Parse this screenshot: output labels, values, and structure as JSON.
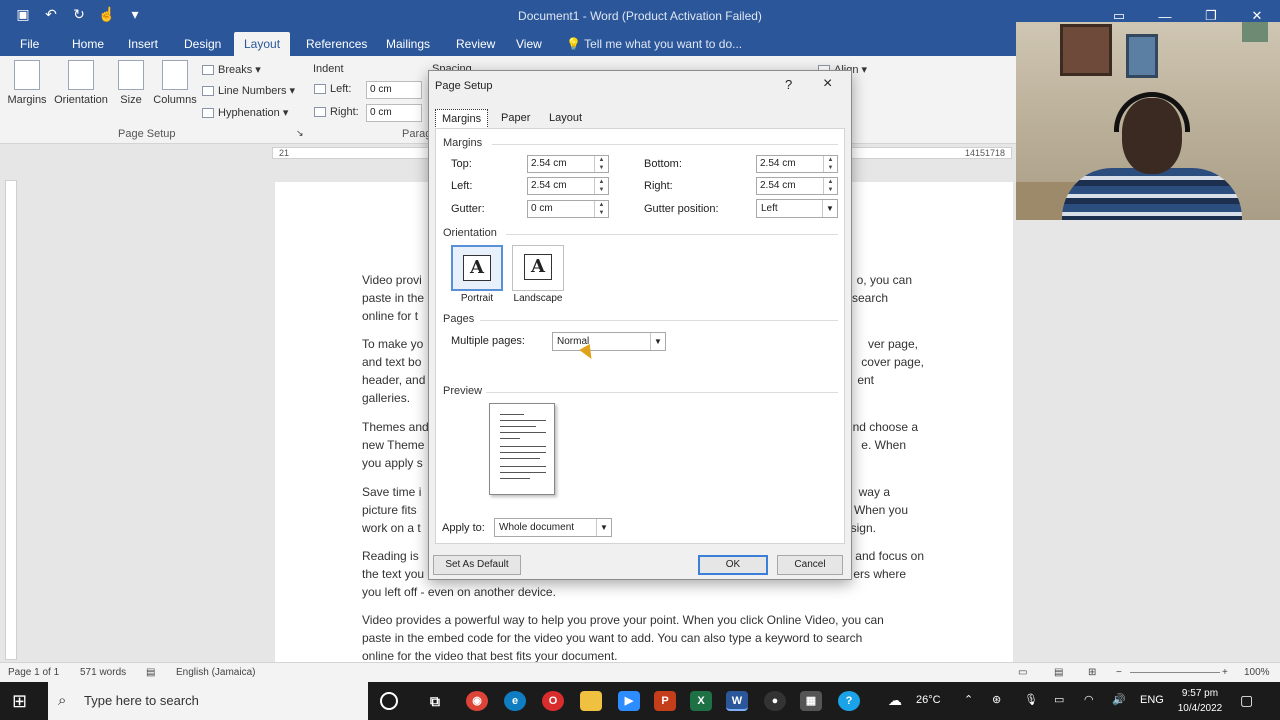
{
  "titlebar": {
    "title": "Document1 - Word (Product Activation Failed)",
    "qat_icons": [
      "save-icon",
      "undo-icon",
      "redo-icon",
      "touch-mode-icon",
      "customize-icon"
    ],
    "win_icons": [
      "ribbon-display-icon",
      "minimize-icon",
      "restore-icon",
      "close-icon"
    ]
  },
  "ribbon_tabs": [
    "File",
    "Home",
    "Insert",
    "Design",
    "Layout",
    "References",
    "Mailings",
    "Review",
    "View"
  ],
  "active_tab": "Layout",
  "tell_me": "Tell me what you want to do...",
  "ribbon": {
    "margins": "Margins",
    "orientation": "Orientation",
    "size": "Size",
    "columns": "Columns",
    "breaks": "Breaks",
    "line_numbers": "Line Numbers",
    "hyphenation": "Hyphenation",
    "page_setup_group": "Page Setup",
    "indent": "Indent",
    "left_label": "Left:",
    "left_value": "0 cm",
    "right_label": "Right:",
    "right_value": "0 cm",
    "spacing": "Spacing",
    "para_group": "Parag",
    "align": "Align"
  },
  "ruler_ticks": [
    "2",
    "1",
    "14",
    "15",
    "17",
    "18"
  ],
  "document": {
    "paragraphs": [
      {
        "left": "Video provi",
        "right": "o, you can"
      },
      {
        "left": "paste in the",
        "right": "search"
      },
      {
        "left": "online for t",
        "right": ""
      },
      {
        "left": "To make yo",
        "right": "ver page,"
      },
      {
        "left": "and text bo",
        "right": "cover page,"
      },
      {
        "left": "header, and",
        "right": "ent"
      },
      {
        "left": "galleries.",
        "right": ""
      },
      {
        "left": "Themes and",
        "right": "nd choose a"
      },
      {
        "left": "new Theme",
        "right": "e. When"
      },
      {
        "left": "you apply s",
        "right": ""
      },
      {
        "left": "Save time i",
        "right": "way a"
      },
      {
        "left": "picture fits",
        "right": "When you"
      },
      {
        "left": "work on a t",
        "right": "sign."
      },
      {
        "left": "Reading is",
        "right": "and focus on"
      },
      {
        "left": "the text you",
        "right": "ers where"
      }
    ],
    "line_left_off": "you left off - even on another device.",
    "video_para": [
      "Video provides a powerful way to help you prove your point. When you click Online Video, you can",
      "paste in the embed code for the video you want to add. You can also type a keyword to search",
      "online for the video that best fits your document."
    ]
  },
  "status": {
    "page": "Page 1 of 1",
    "words": "571 words",
    "language": "English (Jamaica)",
    "zoom": "100%"
  },
  "dialog": {
    "title": "Page Setup",
    "help": "?",
    "close": "×",
    "tabs": [
      "Margins",
      "Paper",
      "Layout"
    ],
    "margins_heading": "Margins",
    "top_label": "Top:",
    "top_value": "2.54 cm",
    "bottom_label": "Bottom:",
    "bottom_value": "2.54 cm",
    "left_label": "Left:",
    "left_value": "2.54 cm",
    "right_label": "Right:",
    "right_value": "2.54 cm",
    "gutter_label": "Gutter:",
    "gutter_value": "0 cm",
    "gutter_pos_label": "Gutter position:",
    "gutter_pos_value": "Left",
    "orientation_heading": "Orientation",
    "portrait": "Portrait",
    "landscape": "Landscape",
    "orient_glyph": "A",
    "pages_heading": "Pages",
    "multiple_pages_label": "Multiple pages:",
    "multiple_pages_value": "Normal",
    "preview_heading": "Preview",
    "apply_to_label": "Apply to:",
    "apply_to_value": "Whole document",
    "set_default": "Set As Default",
    "ok": "OK",
    "cancel": "Cancel"
  },
  "taskbar": {
    "search_placeholder": "Type here to search",
    "weather": "26°C",
    "lang": "ENG",
    "time": "9:57 pm",
    "date": "10/4/2022"
  },
  "colors": {
    "word_blue": "#2b579a",
    "taskbar": "#1b1b1b",
    "accent": "#3c7fd8"
  }
}
